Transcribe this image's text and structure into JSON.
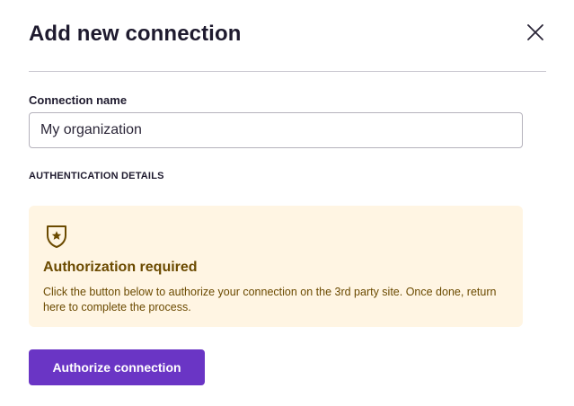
{
  "dialog": {
    "title": "Add new connection",
    "close_icon": "close-icon"
  },
  "form": {
    "connection_name": {
      "label": "Connection name",
      "value": "My organization",
      "placeholder": ""
    },
    "section_heading": "AUTHENTICATION DETAILS"
  },
  "notice": {
    "icon": "shield-star-icon",
    "title": "Authorization required",
    "message": "Click the button below to authorize your connection on the 3rd party site. Once done, return here to complete the process."
  },
  "actions": {
    "authorize_label": "Authorize connection"
  },
  "colors": {
    "accent": "#6a35c5",
    "notice_background": "#fff5e3",
    "notice_text": "#6b4a00"
  }
}
